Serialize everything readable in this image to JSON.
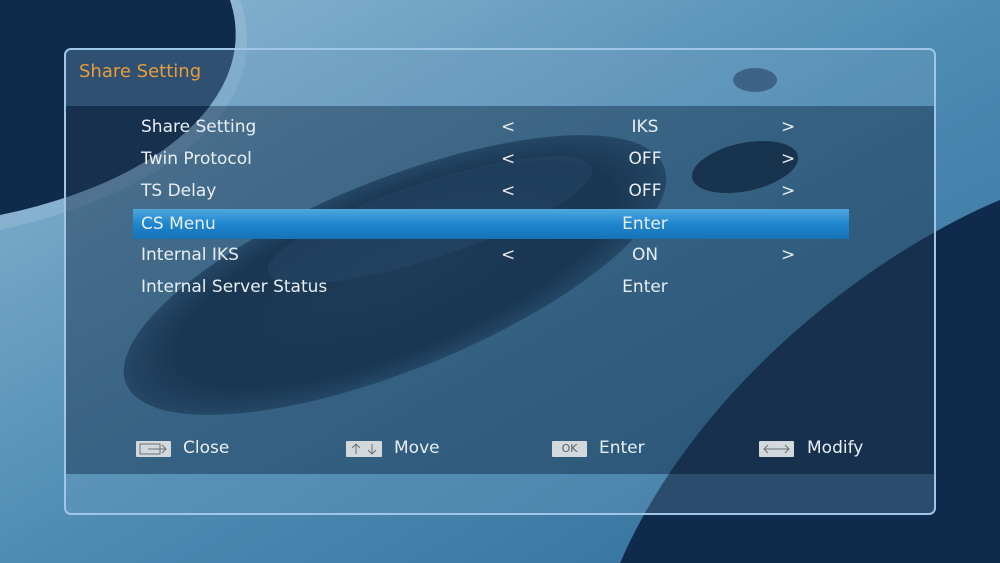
{
  "window": {
    "title": "Share Setting"
  },
  "menu": {
    "items": [
      {
        "label": "Share Setting",
        "value": "IKS",
        "left_arrow": "<",
        "right_arrow": ">"
      },
      {
        "label": "Twin Protocol",
        "value": "OFF",
        "left_arrow": "<",
        "right_arrow": ">"
      },
      {
        "label": "TS Delay",
        "value": "OFF",
        "left_arrow": "<",
        "right_arrow": ">"
      },
      {
        "label": "CS Menu",
        "value": "Enter"
      },
      {
        "label": "Internal IKS",
        "value": "ON",
        "left_arrow": "<",
        "right_arrow": ">"
      },
      {
        "label": "Internal Server Status",
        "value": "Enter"
      }
    ],
    "selected_index": 3
  },
  "footer": {
    "close": {
      "key": "exit-arrow-icon",
      "label": "Close"
    },
    "move": {
      "key": "up-down-arrows-icon",
      "label": "Move"
    },
    "enter": {
      "key_text": "OK",
      "label": "Enter"
    },
    "modify": {
      "key": "left-right-arrows-icon",
      "label": "Modify"
    }
  },
  "colors": {
    "title": "#e79d3a",
    "selection": "#1f86cf",
    "text": "#e8eef4"
  }
}
